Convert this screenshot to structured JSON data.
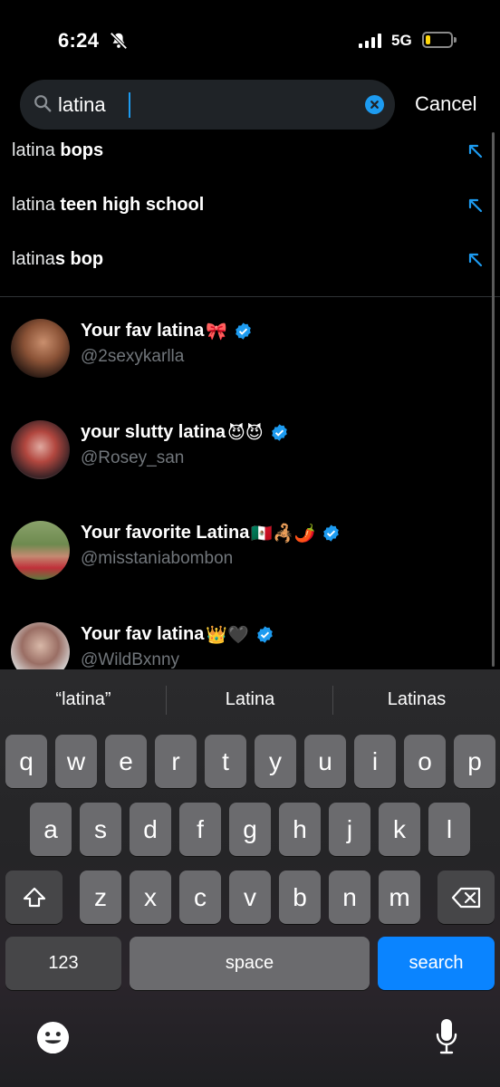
{
  "status": {
    "time": "6:24",
    "network": "5G",
    "battery_level": 0.18
  },
  "search": {
    "value": "latina",
    "cancel_label": "Cancel"
  },
  "suggestions": [
    {
      "prefix": "latina ",
      "bold": "bops"
    },
    {
      "prefix": "latina ",
      "bold": "teen high school"
    },
    {
      "prefix": "latina",
      "bold": "s bop"
    }
  ],
  "users": [
    {
      "name": "Your fav latina",
      "emoji": "🎀",
      "handle": "@2sexykarlla"
    },
    {
      "name": "your slutty latina",
      "emoji": "😈😈",
      "handle": "@Rosey_san"
    },
    {
      "name": "Your favorite Latina",
      "emoji": "🇲🇽🦂🌶️",
      "handle": "@misstaniabombon"
    },
    {
      "name": "Your fav latina",
      "emoji": "👑🖤",
      "handle": "@WildBxnny"
    }
  ],
  "keyboard": {
    "predictions": [
      "“latina”",
      "Latina",
      "Latinas"
    ],
    "row1": [
      "q",
      "w",
      "e",
      "r",
      "t",
      "y",
      "u",
      "i",
      "o",
      "p"
    ],
    "row2": [
      "a",
      "s",
      "d",
      "f",
      "g",
      "h",
      "j",
      "k",
      "l"
    ],
    "row3": [
      "z",
      "x",
      "c",
      "v",
      "b",
      "n",
      "m"
    ],
    "numbers_label": "123",
    "space_label": "space",
    "search_label": "search"
  },
  "colors": {
    "accent": "#1d9bf0",
    "search_key": "#0a84ff",
    "battery": "#ffd60a"
  },
  "icons": [
    "bell-slash-icon",
    "search-icon",
    "clear-icon",
    "arrow-up-left-icon",
    "verified-icon",
    "shift-icon",
    "backspace-icon",
    "emoji-icon",
    "microphone-icon"
  ]
}
